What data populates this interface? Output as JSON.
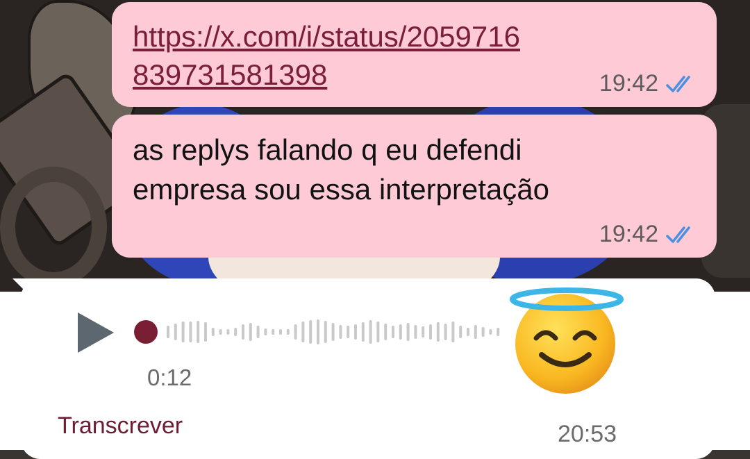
{
  "messages": [
    {
      "text": "https://x.com/i/status/2059716839731581398",
      "time": "19:42",
      "status": "read",
      "is_link": true
    },
    {
      "text": "as replys falando q eu defendi empresa sou essa interpretação",
      "time": "19:42",
      "status": "read"
    }
  ],
  "voice_message": {
    "duration": "0:12",
    "time": "20:53",
    "transcribe_label": "Transcrever",
    "progress": 0,
    "play_icon": "play-icon",
    "avatar_emoji": "smiling-face-with-halo"
  },
  "colors": {
    "outgoing_bubble": "#fdcad6",
    "incoming_bubble": "#ffffff",
    "link": "#7a1e3a",
    "read_ticks": "#4a8fe0",
    "playhead": "#7a1e34"
  }
}
